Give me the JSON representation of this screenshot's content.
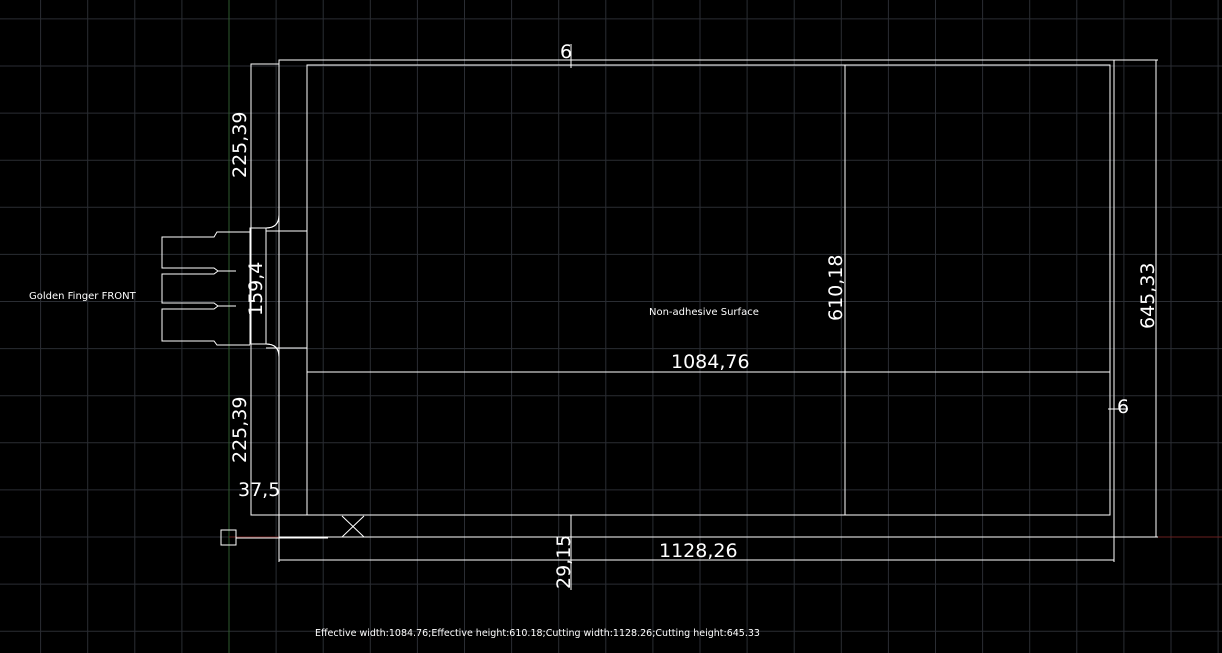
{
  "labels": {
    "golden_finger": "Golden Finger FRONT",
    "surface": "Non-adhesive Surface",
    "summary": "Effective width:1084.76;Effective height:610.18;Cutting width:1128.26;Cutting height:645.33"
  },
  "dimensions": {
    "top_offset": "6",
    "right_offset": "6",
    "left_upper": "225,39",
    "left_middle": "159,4",
    "left_lower": "225,39",
    "finger_length": "37,5",
    "bottom_offset": "29,15",
    "effective_width": "1084,76",
    "effective_height": "610,18",
    "cutting_width": "1128,26",
    "cutting_height": "645,33"
  },
  "colors": {
    "background": "#000000",
    "grid": "#2a2d33",
    "stroke": "#ffffff",
    "axis_y": "#2e5a2e",
    "axis_x": "#6a1f1f"
  }
}
